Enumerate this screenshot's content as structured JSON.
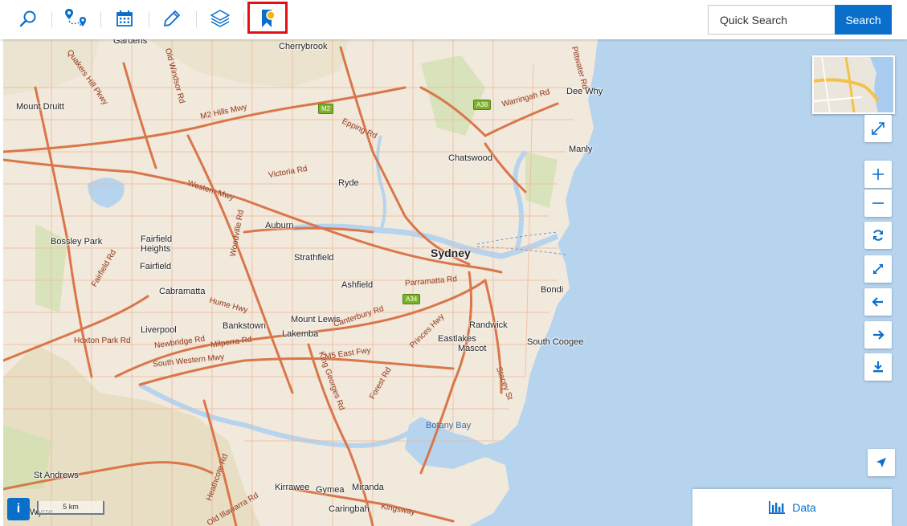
{
  "toolbar": {
    "tools": [
      "search-tool",
      "route-tool",
      "calendar-tool",
      "draw-tool",
      "layers-tool",
      "bookmark-tool"
    ],
    "quick_search_placeholder": "Quick Search",
    "search_label": "Search"
  },
  "colors": {
    "accent": "#0a6ecb",
    "highlight": "#e3101a",
    "water": "#b7d4ef",
    "land": "#f3ece0",
    "road": "#e0835a"
  },
  "map": {
    "places": [
      {
        "name": "Gardens",
        "kind": "suburb"
      },
      {
        "name": "Cherrybrook",
        "kind": "suburb"
      },
      {
        "name": "Mount Druitt",
        "kind": "suburb"
      },
      {
        "name": "Dee Why",
        "kind": "suburb"
      },
      {
        "name": "Manly",
        "kind": "suburb"
      },
      {
        "name": "Chatswood",
        "kind": "suburb"
      },
      {
        "name": "Ryde",
        "kind": "suburb"
      },
      {
        "name": "Auburn",
        "kind": "suburb"
      },
      {
        "name": "Bossley Park",
        "kind": "suburb"
      },
      {
        "name": "Fairfield Heights",
        "kind": "suburb"
      },
      {
        "name": "Fairfield",
        "kind": "suburb"
      },
      {
        "name": "Strathfield",
        "kind": "suburb"
      },
      {
        "name": "Sydney",
        "kind": "city"
      },
      {
        "name": "Ashfield",
        "kind": "suburb"
      },
      {
        "name": "Cabramatta",
        "kind": "suburb"
      },
      {
        "name": "Bondi",
        "kind": "suburb"
      },
      {
        "name": "Mount Lewis",
        "kind": "suburb"
      },
      {
        "name": "Bankstown",
        "kind": "suburb"
      },
      {
        "name": "Lakemba",
        "kind": "suburb"
      },
      {
        "name": "Liverpool",
        "kind": "suburb"
      },
      {
        "name": "Randwick",
        "kind": "suburb"
      },
      {
        "name": "Eastlakes",
        "kind": "suburb"
      },
      {
        "name": "Mascot",
        "kind": "suburb"
      },
      {
        "name": "South Coogee",
        "kind": "suburb"
      },
      {
        "name": "Botany Bay",
        "kind": "water"
      },
      {
        "name": "St Andrews",
        "kind": "suburb"
      },
      {
        "name": "Kirrawee",
        "kind": "suburb"
      },
      {
        "name": "Gymea",
        "kind": "suburb"
      },
      {
        "name": "Miranda",
        "kind": "suburb"
      },
      {
        "name": "Caringbah",
        "kind": "suburb"
      },
      {
        "name": "Wyrre",
        "kind": "suburb"
      }
    ],
    "roads": [
      "M2 Hills Mwy",
      "Western Mwy",
      "Hume Hwy",
      "M5 East Fwy",
      "South Western Mwy",
      "Victoria Rd",
      "Epping Rd",
      "Parramatta Rd",
      "Canterbury Rd",
      "Princes Hwy",
      "Newbridge Rd",
      "Hoxton Park Rd",
      "Milperra Rd",
      "Quakers Hill Pkwy",
      "Old Windsor Rd",
      "Warringah Rd",
      "Pittwater Rd",
      "Woodville Rd",
      "Stacey St",
      "Forest Rd",
      "Kingsway",
      "Heathcote Rd",
      "Old Illawarra Rd",
      "Fairfield Rd",
      "King Georges Rd"
    ],
    "shields": [
      "M2",
      "A38",
      "A34"
    ],
    "scale_label": "5 km"
  },
  "controls": {
    "icons": [
      "expand-icon",
      "zoom-in-icon",
      "zoom-out-icon",
      "refresh-icon",
      "full-extent-icon",
      "back-icon",
      "forward-icon",
      "download-icon"
    ],
    "info_label": "i",
    "data_label": "Data"
  }
}
